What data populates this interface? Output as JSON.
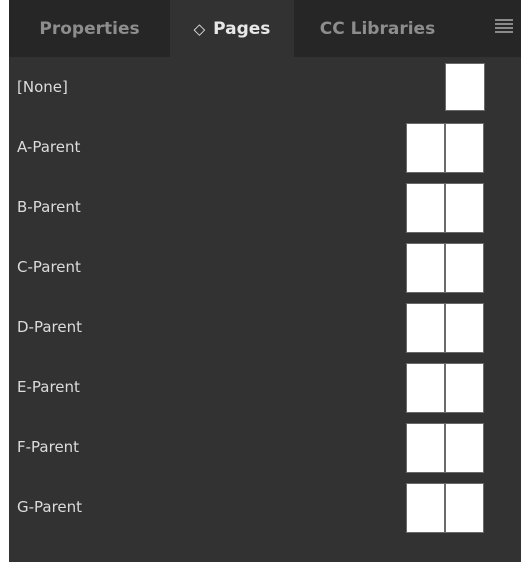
{
  "tabs": [
    {
      "label": "Properties",
      "active": false
    },
    {
      "label": "Pages",
      "active": true
    },
    {
      "label": "CC Libraries",
      "active": false
    }
  ],
  "active_tab_marker": "◇",
  "menu_icon": "hamburger-menu-icon",
  "parents": [
    {
      "label": "[None]",
      "pages": 1
    },
    {
      "label": "A-Parent",
      "pages": 2
    },
    {
      "label": "B-Parent",
      "pages": 2
    },
    {
      "label": "C-Parent",
      "pages": 2
    },
    {
      "label": "D-Parent",
      "pages": 2
    },
    {
      "label": "E-Parent",
      "pages": 2
    },
    {
      "label": "F-Parent",
      "pages": 2
    },
    {
      "label": "G-Parent",
      "pages": 2
    }
  ],
  "colors": {
    "panel_bg": "#323232",
    "tabbar_bg": "#262626",
    "text": "#dcdcdc",
    "thumb": "#ffffff"
  }
}
